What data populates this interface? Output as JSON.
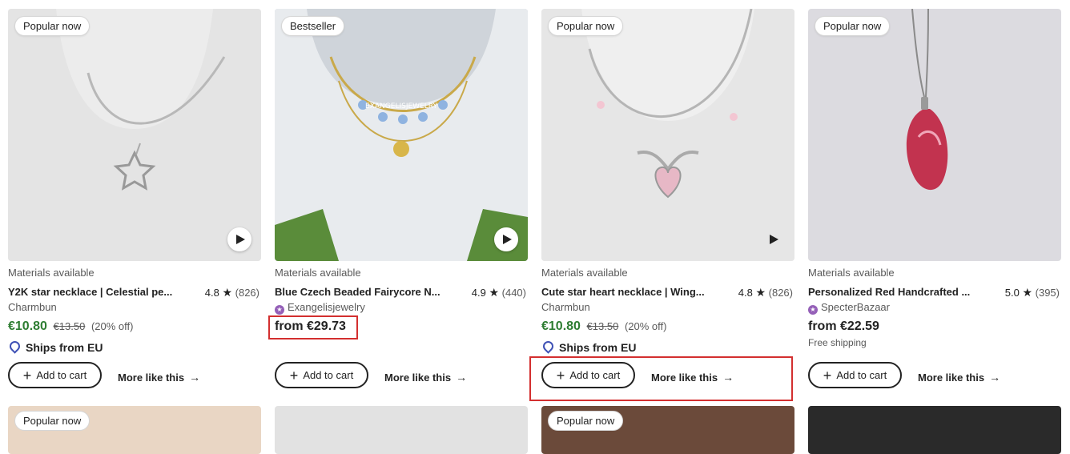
{
  "listings": [
    {
      "badge": "Popular now",
      "materials": "Materials available",
      "title": "Y2K star necklace | Celestial pe...",
      "rating": "4.8",
      "reviews": "(826)",
      "shop": "Charmbun",
      "price": "€10.80",
      "old_price": "€13.50",
      "discount": "(20% off)",
      "ships": "Ships from EU",
      "add_to_cart": "Add to cart",
      "more_like_this": "More like this"
    },
    {
      "badge": "Bestseller",
      "materials": "Materials available",
      "title": "Blue Czech Beaded Fairycore N...",
      "rating": "4.9",
      "reviews": "(440)",
      "shop": "Exangelisjewelry",
      "price": "from €29.73",
      "add_to_cart": "Add to cart",
      "more_like_this": "More like this",
      "watermark": "EXANGELISJEWELRY"
    },
    {
      "badge": "Popular now",
      "materials": "Materials available",
      "title": "Cute star heart necklace | Wing...",
      "rating": "4.8",
      "reviews": "(826)",
      "shop": "Charmbun",
      "price": "€10.80",
      "old_price": "€13.50",
      "discount": "(20% off)",
      "ships": "Ships from EU",
      "add_to_cart": "Add to cart",
      "more_like_this": "More like this"
    },
    {
      "badge": "Popular now",
      "materials": "Materials available",
      "title": "Personalized Red Handcrafted ...",
      "rating": "5.0",
      "reviews": "(395)",
      "shop": "SpecterBazaar",
      "price": "from €22.59",
      "shipping": "Free shipping",
      "add_to_cart": "Add to cart",
      "more_like_this": "More like this"
    }
  ],
  "next_row": [
    {
      "badge": "Popular now"
    },
    {
      "badge": ""
    },
    {
      "badge": "Popular now"
    },
    {
      "badge": ""
    }
  ],
  "colors": {
    "sale_price": "#2e7d32",
    "highlight": "#d32f2f",
    "star_seller": "#9560b8",
    "pin": "#3f51b5"
  }
}
